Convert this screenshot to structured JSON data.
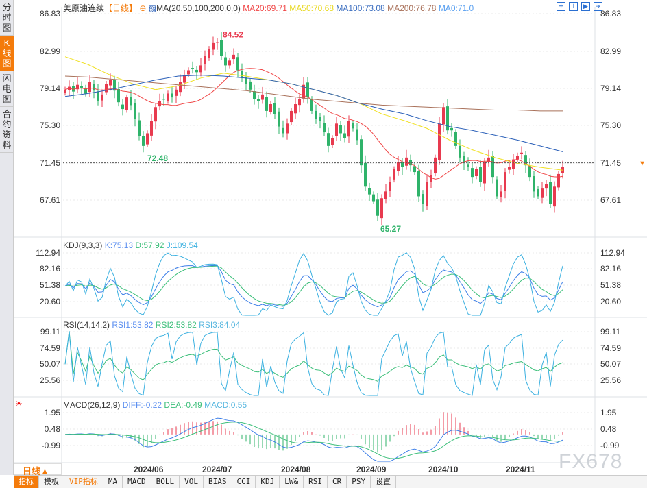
{
  "sidebar": {
    "items": [
      {
        "label": "分时图"
      },
      {
        "label": "K线图",
        "active": true
      },
      {
        "label": "闪电图"
      },
      {
        "label": "合约资料"
      }
    ]
  },
  "header": {
    "symbol": "美原油连续",
    "period": "【日线】",
    "ma_params": "MA(20,50,100,200,0,0)",
    "ma20": "MA20:69.71",
    "ma50": "MA50:70.68",
    "ma100": "MA100:73.08",
    "ma200": "MA200:76.78",
    "ma0": "MA0:71.0",
    "icons": [
      "crosshair-icon",
      "zoom-range-icon",
      "play-icon",
      "jump-end-icon"
    ]
  },
  "colors": {
    "up": "#e83a4f",
    "down": "#2fb36a",
    "ma20": "#f04646",
    "ma50": "#f0e020",
    "ma100": "#2a5fb8",
    "ma200": "#a9715a",
    "ma0": "#5aa0f0",
    "accent": "#f47b0b"
  },
  "main": {
    "y_ticks": [
      "86.83",
      "82.99",
      "79.14",
      "75.30",
      "71.45",
      "67.61"
    ],
    "high_label": "84.52",
    "low_label_1": "72.48",
    "low_label_2": "65.27",
    "last_price": 71.45,
    "closes": [
      79.0,
      79.3,
      78.8,
      79.5,
      79.2,
      78.6,
      79.8,
      78.9,
      77.8,
      78.5,
      79.6,
      80.0,
      78.9,
      77.7,
      77.0,
      78.2,
      77.4,
      76.0,
      74.2,
      73.2,
      74.5,
      75.8,
      77.2,
      77.8,
      78.0,
      78.6,
      78.2,
      79.0,
      79.8,
      80.5,
      81.0,
      81.2,
      80.8,
      81.5,
      82.5,
      83.2,
      83.8,
      83.9,
      82.5,
      81.5,
      82.0,
      82.6,
      81.0,
      80.2,
      79.6,
      79.0,
      78.0,
      77.8,
      78.5,
      76.8,
      77.5,
      76.5,
      75.2,
      74.5,
      75.5,
      76.8,
      77.5,
      78.0,
      79.5,
      78.2,
      76.8,
      76.0,
      75.8,
      74.6,
      73.2,
      74.0,
      75.5,
      74.5,
      74.0,
      75.8,
      75.0,
      73.8,
      71.2,
      69.0,
      68.2,
      67.5,
      66.0,
      67.8,
      68.5,
      69.5,
      70.8,
      71.5,
      71.0,
      72.0,
      71.2,
      70.5,
      68.0,
      67.2,
      69.5,
      70.2,
      72.0,
      75.5,
      77.2,
      74.8,
      74.8,
      73.2,
      72.0,
      71.5,
      71.0,
      70.0,
      70.8,
      69.5,
      71.5,
      72.0,
      70.0,
      68.0,
      68.5,
      70.5,
      71.0,
      71.8,
      72.2,
      72.5,
      71.2,
      70.0,
      68.5,
      68.0,
      68.8,
      69.3,
      67.2,
      69.0,
      70.3,
      71.0
    ],
    "ma50": [
      82.4,
      81.6,
      80.5,
      79.6,
      79.0,
      79.4,
      80.2,
      80.7,
      80.4,
      80.0,
      79.6,
      79.0,
      78.4,
      77.6,
      76.5,
      75.8,
      75.0,
      73.8,
      72.8,
      72.0,
      71.4,
      71.0,
      70.7
    ],
    "ma100": [
      78.3,
      78.6,
      79.0,
      79.5,
      80.0,
      80.4,
      80.5,
      80.4,
      80.2,
      80.0,
      79.6,
      79.0,
      78.4,
      77.6,
      77.0,
      76.5,
      75.8,
      75.2,
      74.8,
      74.3,
      73.8,
      73.2,
      72.6
    ],
    "ma200": [
      80.4,
      80.3,
      80.1,
      79.9,
      79.7,
      79.5,
      79.3,
      79.1,
      78.9,
      78.6,
      78.3,
      78.0,
      77.8,
      77.6,
      77.4,
      77.3,
      77.2,
      77.1,
      77.0,
      76.9,
      76.9,
      76.8,
      76.8
    ]
  },
  "kdj": {
    "title": "KDJ(9,3,3)",
    "k": "K:75.13",
    "d": "D:57.92",
    "j": "J:109.54",
    "y_ticks": [
      "112.94",
      "82.16",
      "51.38",
      "20.60"
    ]
  },
  "rsi": {
    "title": "RSI(14,14,2)",
    "rsi1": "RSI1:53.82",
    "rsi2": "RSI2:53.82",
    "rsi3": "RSI3:84.04",
    "y_ticks": [
      "99.11",
      "74.59",
      "50.07",
      "25.56"
    ]
  },
  "macd": {
    "title": "MACD(26,12,9)",
    "diff": "DIFF:-0.22",
    "dea": "DEA:-0.49",
    "macd": "MACD:0.55",
    "y_ticks": [
      "1.95",
      "0.48",
      "-0.99"
    ]
  },
  "x_axis": {
    "period_button": "日线▲",
    "dates": [
      "2024/06",
      "2024/07",
      "2024/08",
      "2024/09",
      "2024/10",
      "2024/11"
    ]
  },
  "toolbar": [
    "指标",
    "模板",
    "VIP指标",
    "MA",
    "MACD",
    "BOLL",
    "VOL",
    "BIAS",
    "CCI",
    "KDJ",
    "LW&",
    "RSI",
    "CR",
    "PSY",
    "设置"
  ],
  "watermark": "FX678"
}
